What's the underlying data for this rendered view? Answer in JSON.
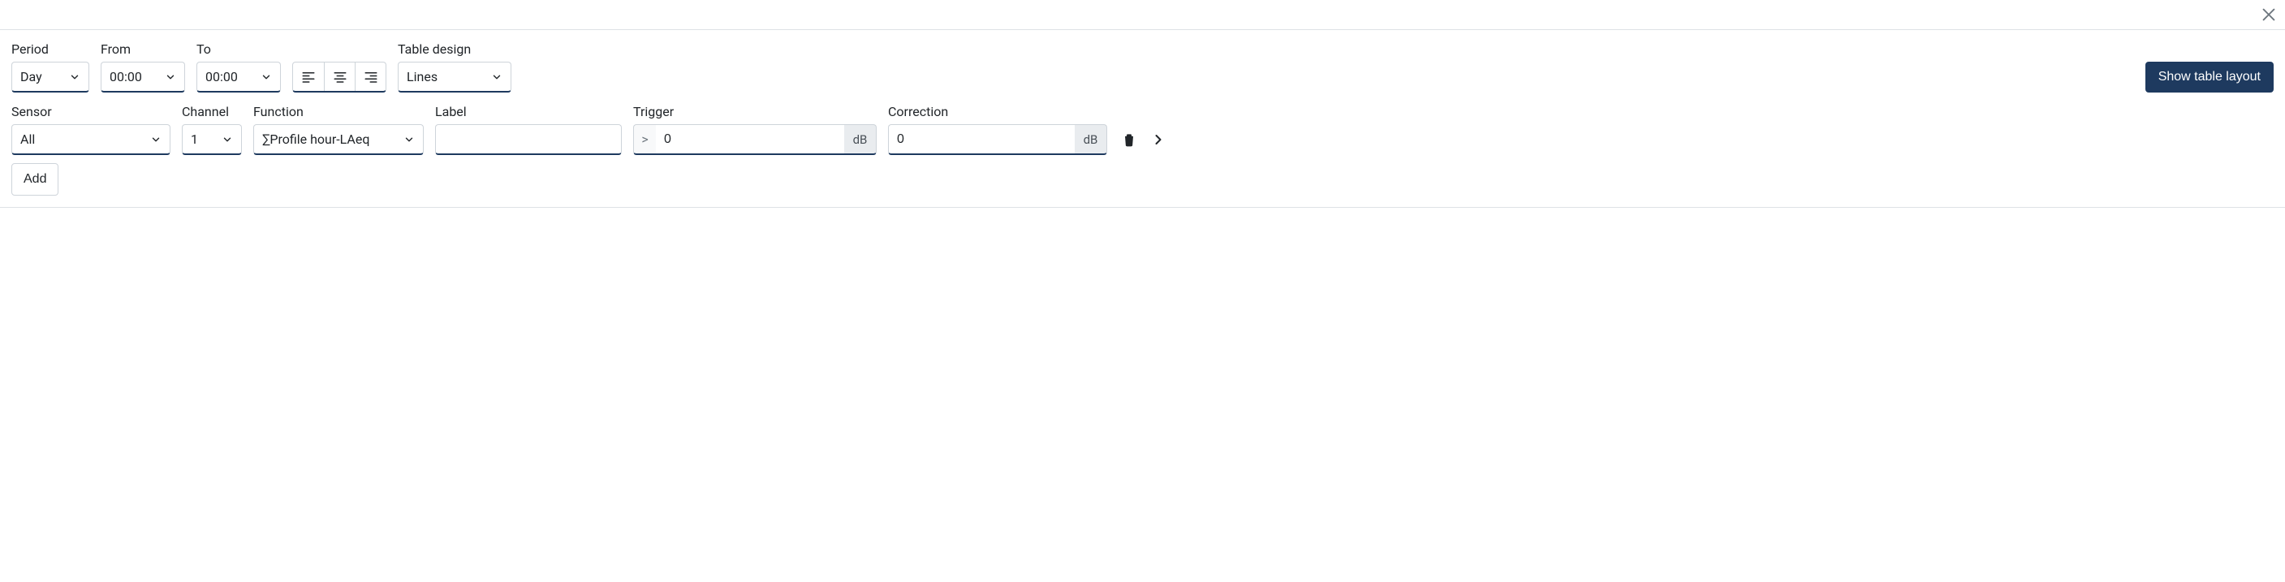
{
  "close_label": "Close",
  "toolbar": {
    "period": {
      "label": "Period",
      "value": "Day"
    },
    "from": {
      "label": "From",
      "value": "00:00"
    },
    "to": {
      "label": "To",
      "value": "00:00"
    },
    "table_design": {
      "label": "Table design",
      "value": "Lines"
    },
    "align": {
      "left": "Align left",
      "center": "Align center",
      "right": "Align right"
    },
    "show_layout": "Show table layout"
  },
  "row": {
    "sensor": {
      "label": "Sensor",
      "value": "All"
    },
    "channel": {
      "label": "Channel",
      "value": "1"
    },
    "function": {
      "label": "Function",
      "value": "∑Profile hour-LAeq"
    },
    "labelcol": {
      "label": "Label",
      "value": ""
    },
    "trigger": {
      "label": "Trigger",
      "op": ">",
      "value": "0",
      "unit": "dB"
    },
    "correction": {
      "label": "Correction",
      "value": "0",
      "unit": "dB"
    }
  },
  "buttons": {
    "add": "Add",
    "delete": "Delete",
    "expand": "Expand"
  }
}
